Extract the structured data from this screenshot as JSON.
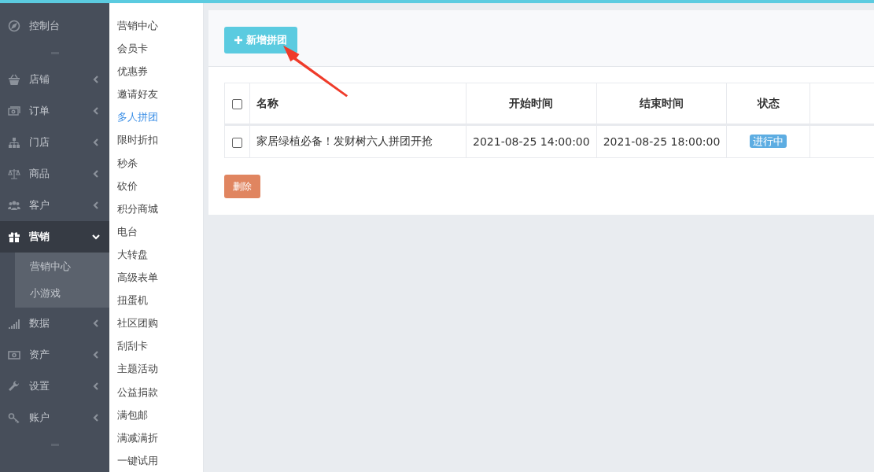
{
  "nav": {
    "dashboard": {
      "label": "控制台"
    },
    "items": [
      {
        "label": "店铺",
        "expanded": false,
        "selected": false
      },
      {
        "label": "订单",
        "expanded": false,
        "selected": false
      },
      {
        "label": "门店",
        "expanded": false,
        "selected": false
      },
      {
        "label": "商品",
        "expanded": false,
        "selected": false
      },
      {
        "label": "客户",
        "expanded": false,
        "selected": false
      },
      {
        "label": "营销",
        "expanded": true,
        "selected": true,
        "children": [
          {
            "label": "营销中心"
          },
          {
            "label": "小游戏"
          }
        ]
      },
      {
        "label": "数据",
        "expanded": false,
        "selected": false
      },
      {
        "label": "资产",
        "expanded": false,
        "selected": false
      },
      {
        "label": "设置",
        "expanded": false,
        "selected": false
      },
      {
        "label": "账户",
        "expanded": false,
        "selected": false
      }
    ]
  },
  "submenu": [
    {
      "label": "营销中心",
      "selected": false
    },
    {
      "label": "会员卡",
      "selected": false
    },
    {
      "label": "优惠券",
      "selected": false
    },
    {
      "label": "邀请好友",
      "selected": false
    },
    {
      "label": "多人拼团",
      "selected": true
    },
    {
      "label": "限时折扣",
      "selected": false
    },
    {
      "label": "秒杀",
      "selected": false
    },
    {
      "label": "砍价",
      "selected": false
    },
    {
      "label": "积分商城",
      "selected": false
    },
    {
      "label": "电台",
      "selected": false
    },
    {
      "label": "大转盘",
      "selected": false
    },
    {
      "label": "高级表单",
      "selected": false
    },
    {
      "label": "扭蛋机",
      "selected": false
    },
    {
      "label": "社区团购",
      "selected": false
    },
    {
      "label": "刮刮卡",
      "selected": false
    },
    {
      "label": "主题活动",
      "selected": false
    },
    {
      "label": "公益捐款",
      "selected": false
    },
    {
      "label": "满包邮",
      "selected": false
    },
    {
      "label": "满减满折",
      "selected": false
    },
    {
      "label": "一键试用",
      "selected": false
    }
  ],
  "add_button": {
    "label": "新增拼团"
  },
  "table": {
    "select_all": {
      "checked": false
    },
    "columns": [
      "名称",
      "开始时间",
      "结束时间",
      "状态"
    ],
    "rows": [
      {
        "checked": false,
        "name": "家居绿植必备！发财树六人拼团开抢",
        "start": "2021-08-25 14:00:00",
        "end": "2021-08-25 18:00:00",
        "status": "进行中"
      }
    ]
  },
  "delete_button": {
    "label": "删除"
  }
}
